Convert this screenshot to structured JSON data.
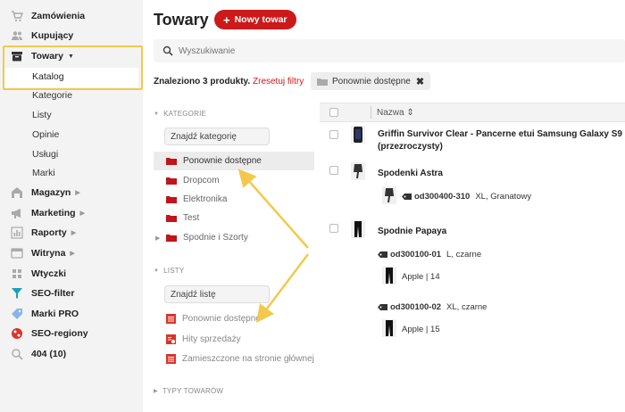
{
  "sidebar": {
    "items": [
      {
        "label": "Zamówienia",
        "icon": "cart-icon"
      },
      {
        "label": "Kupujący",
        "icon": "users-icon"
      },
      {
        "label": "Towary",
        "icon": "box-icon"
      },
      {
        "label": "Magazyn",
        "icon": "warehouse-icon"
      },
      {
        "label": "Marketing",
        "icon": "megaphone-icon"
      },
      {
        "label": "Raporty",
        "icon": "chart-icon"
      },
      {
        "label": "Witryna",
        "icon": "storefront-icon"
      },
      {
        "label": "Wtyczki",
        "icon": "plug-icon"
      },
      {
        "label": "SEO-filter",
        "icon": "filter-icon"
      },
      {
        "label": "Marki PRO",
        "icon": "tag-icon"
      },
      {
        "label": "SEO-regiony",
        "icon": "regions-icon"
      },
      {
        "label": "404 (10)",
        "icon": "search-icon"
      }
    ],
    "towary_sub": [
      "Katalog",
      "Kategorie",
      "Listy",
      "Opinie",
      "Usługi",
      "Marki"
    ]
  },
  "header": {
    "title": "Towary",
    "new_button": "Nowy towar"
  },
  "search": {
    "placeholder": "Wyszukiwanie"
  },
  "results": {
    "found": "Znaleziono 3 produkty.",
    "reset": "Zresetuj filtry",
    "chip": "Ponownie dostępne"
  },
  "filters": {
    "categories_title": "KATEGORIE",
    "categories_placeholder": "Znajdź kategorię",
    "categories": [
      "Ponownie dostępne",
      "Dropcom",
      "Elektronika",
      "Test",
      "Spodnie i Szorty"
    ],
    "lists_title": "LISTY",
    "lists_placeholder": "Znajdź listę",
    "lists": [
      "Ponownie dostępne",
      "Hity sprzedaży",
      "Zamieszczone na stronie głównej"
    ],
    "types_title": "TYPY TOWARÓW"
  },
  "table": {
    "column_name": "Nazwa ⇕",
    "products": [
      {
        "name_line1": "Griffin Survivor Clear - Pancerne etui Samsung Galaxy S9",
        "name_line2": "(przezroczysty)"
      },
      {
        "name_line1": "Spodenki Astra",
        "variant_sku": "od300400-310",
        "variant_desc": "XL, Granatowy"
      },
      {
        "name_line1": "Spodnie Papaya",
        "variants": [
          {
            "sku": "od300100-01",
            "desc": "L, czarne",
            "store": "Apple | 14"
          },
          {
            "sku": "od300100-02",
            "desc": "XL, czarne",
            "store": "Apple | 15"
          }
        ]
      }
    ]
  },
  "colors": {
    "accent": "#cc1a1a",
    "highlight": "#f2c94c",
    "folder": "#c0151a"
  }
}
